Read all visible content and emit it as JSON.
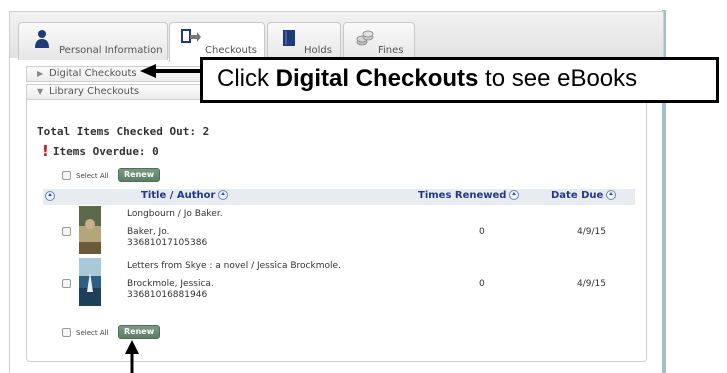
{
  "tabs": [
    {
      "label": "Personal Information",
      "icon": "person-icon",
      "active": false
    },
    {
      "label": "Checkouts",
      "icon": "checkouts-icon",
      "active": true
    },
    {
      "label": "Holds",
      "icon": "book-icon",
      "active": false
    },
    {
      "label": "Fines",
      "icon": "coins-icon",
      "active": false
    }
  ],
  "accordion": {
    "digital": "Digital Checkouts",
    "library": "Library Checkouts"
  },
  "summary": {
    "total": "Total Items Checked Out: 2",
    "overdue": "Items Overdue: 0"
  },
  "controls": {
    "select_all": "Select All",
    "renew": "Renew"
  },
  "columns": {
    "title": "Title / Author",
    "renewed": "Times Renewed",
    "due": "Date Due"
  },
  "items": [
    {
      "title": "Longbourn / Jo Baker.",
      "author": "Baker, Jo.",
      "barcode": "33681017105386",
      "renewed": "0",
      "due": "4/9/15"
    },
    {
      "title": "Letters from Skye : a novel / Jessica Brockmole.",
      "author": "Brockmole, Jessica.",
      "barcode": "33681016881946",
      "renewed": "0",
      "due": "4/9/15"
    }
  ],
  "callout": {
    "prefix": "Click ",
    "bold": "Digital Checkouts",
    "suffix": " to see eBooks"
  },
  "colors": {
    "accent": "#23378e",
    "button": "#5d7d67",
    "alert": "#c0191d"
  }
}
